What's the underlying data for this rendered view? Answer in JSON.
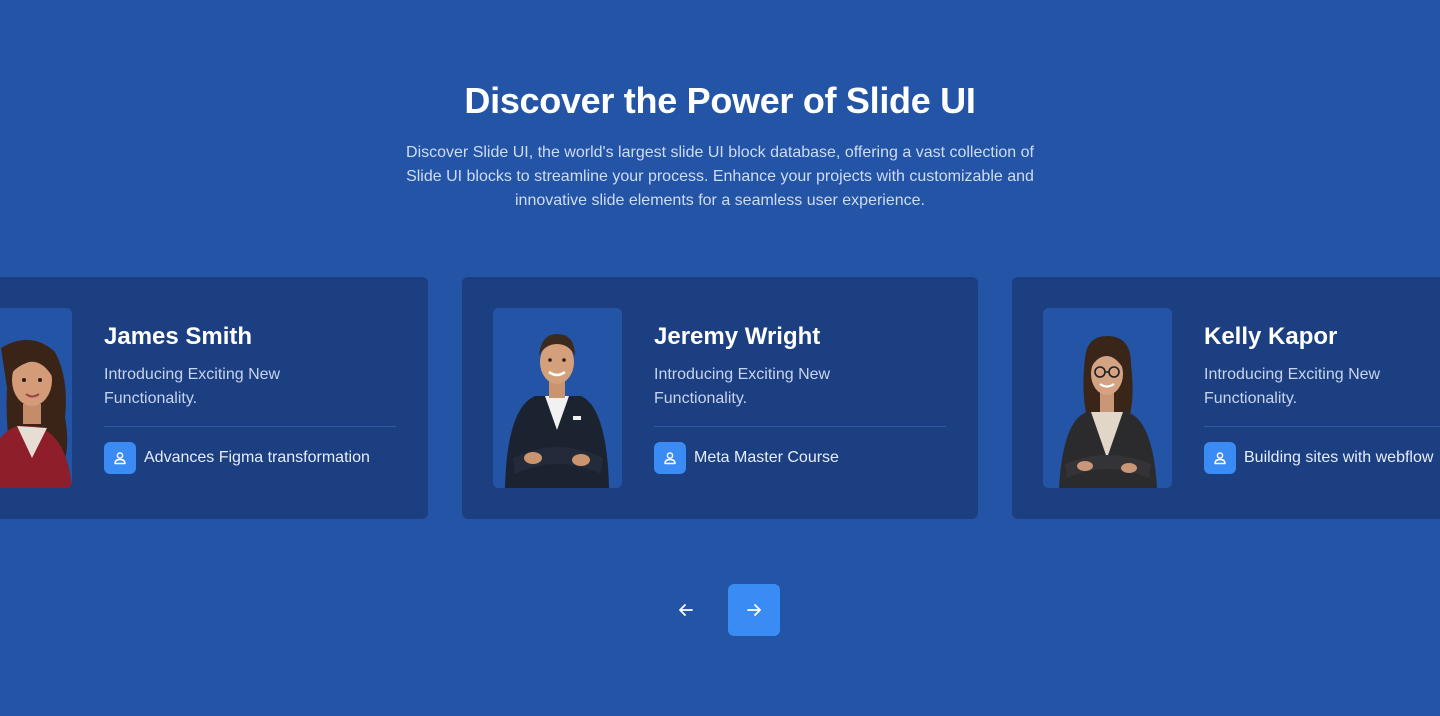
{
  "header": {
    "title": "Discover the Power of Slide UI",
    "subtitle": "Discover Slide UI, the world's largest slide UI block database, offering a vast collection of Slide UI blocks to streamline your process. Enhance your projects with customizable and innovative slide elements for a seamless user experience."
  },
  "cards": [
    {
      "name": "James Smith",
      "description": "Introducing Exciting New Functionality.",
      "course": "Advances Figma transformation",
      "course_icon": "user-icon",
      "photo": "woman-red-blazer-portrait"
    },
    {
      "name": "Jeremy Wright",
      "description": "Introducing Exciting New Functionality.",
      "course": "Meta Master Course",
      "course_icon": "user-icon",
      "photo": "man-dark-suit-portrait"
    },
    {
      "name": "Kelly Kapor",
      "description": "Introducing Exciting New Functionality.",
      "course": "Building sites with webflow",
      "course_icon": "user-icon",
      "photo": "woman-glasses-portrait"
    }
  ],
  "navigation": {
    "prev_icon": "arrow-left-icon",
    "next_icon": "arrow-right-icon"
  },
  "colors": {
    "background": "#2354a5",
    "card": "#1c3f82",
    "accent": "#3b8bf5"
  }
}
